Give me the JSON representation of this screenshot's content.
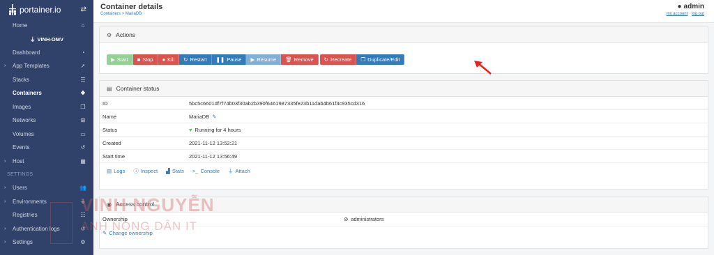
{
  "sidebar": {
    "logo_text": "portainer.io",
    "endpoint": "VINH-OMV",
    "items_top": [
      {
        "label": "Home",
        "icon": "home-icon"
      }
    ],
    "items_endpoint": [
      {
        "label": "Dashboard",
        "icon": "dashboard-icon",
        "chevron": false
      },
      {
        "label": "App Templates",
        "icon": "rocket-icon",
        "chevron": true
      },
      {
        "label": "Stacks",
        "icon": "list-icon",
        "chevron": false
      },
      {
        "label": "Containers",
        "icon": "cubes-icon",
        "chevron": false,
        "active": true
      },
      {
        "label": "Images",
        "icon": "clone-icon",
        "chevron": false
      },
      {
        "label": "Networks",
        "icon": "sitemap-icon",
        "chevron": false
      },
      {
        "label": "Volumes",
        "icon": "hdd-icon",
        "chevron": false
      },
      {
        "label": "Events",
        "icon": "history-icon",
        "chevron": false
      },
      {
        "label": "Host",
        "icon": "th-icon",
        "chevron": true
      }
    ],
    "settings_heading": "SETTINGS",
    "items_settings": [
      {
        "label": "Users",
        "icon": "users-icon",
        "chevron": true
      },
      {
        "label": "Environments",
        "icon": "plug-icon",
        "chevron": true
      },
      {
        "label": "Registries",
        "icon": "database-icon",
        "chevron": false
      },
      {
        "label": "Authentication logs",
        "icon": "history-icon",
        "chevron": true
      },
      {
        "label": "Settings",
        "icon": "cogs-icon",
        "chevron": true
      }
    ]
  },
  "header": {
    "title": "Container details",
    "breadcrumb": "Containers > MariaDB",
    "user": "admin",
    "my_account": "my account",
    "log_out": "log out"
  },
  "actions": {
    "title": "Actions",
    "buttons": {
      "start": "Start",
      "stop": "Stop",
      "kill": "Kill",
      "restart": "Restart",
      "pause": "Pause",
      "resume": "Resume",
      "remove": "Remove",
      "recreate": "Recreate",
      "duplicate": "Duplicate/Edit"
    }
  },
  "status": {
    "title": "Container status",
    "rows": [
      {
        "key": "ID",
        "value": "5bc5c6601df7f74b03f30ab2b390f6461987335fe23b11dab4b61f4c935cd316"
      },
      {
        "key": "Name",
        "value": "MariaDB"
      },
      {
        "key": "Status",
        "value": "Running for 4 hours"
      },
      {
        "key": "Created",
        "value": "2021-11-12 13:52:21"
      },
      {
        "key": "Start time",
        "value": "2021-11-12 13:56:49"
      }
    ],
    "links": {
      "logs": "Logs",
      "inspect": "Inspect",
      "stats": "Stats",
      "console": "Console",
      "attach": "Attach"
    }
  },
  "access": {
    "title": "Access control",
    "ownership_label": "Ownership",
    "ownership_value": "administrators",
    "change_ownership": "Change ownership"
  },
  "watermark": {
    "line1": "VINH NGUYỄN",
    "line2": "ANH NÔNG DÂN IT"
  },
  "colors": {
    "sidebar": "#30426a",
    "success": "#5cb85c",
    "danger": "#d9534f",
    "primary": "#337ab7",
    "running": "#5cb85c"
  }
}
